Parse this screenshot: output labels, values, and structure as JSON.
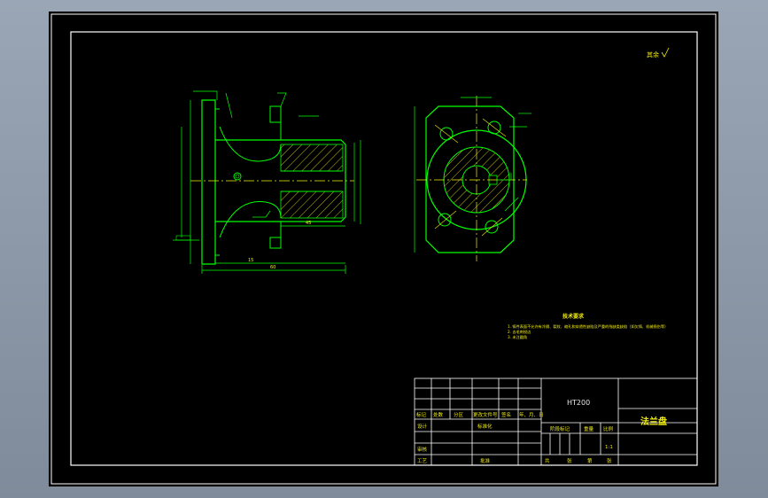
{
  "colors": {
    "background": "#000000",
    "frame": "#ffffff",
    "outline": "#00ff00",
    "text": "#f2ee10",
    "hatch": "#f2ee10",
    "centerline": "#f2ee10",
    "dimension": "#00ff00"
  },
  "drawing": {
    "roughness_note": "其余",
    "technical_requirements_title": "技术要求",
    "technical_requirements_line1": "1. 铸件表面不允许有冷隔、裂纹、缩孔和穿透性缺陷及严重的残缺类缺陷（如欠铸、机械损伤等）",
    "technical_requirements_line2": "2. 去毛刺锐边",
    "technical_requirements_line3": "3. 未注圆角",
    "dim_total_length": "60",
    "dim_flange": "15",
    "dim_shaft": "45"
  },
  "title_block": {
    "material": "HT200",
    "part_name": "法兰盘",
    "col_mark": "标记",
    "col_count": "处数",
    "col_zone": "分区",
    "col_change_doc": "更改文件号",
    "col_sign": "签名",
    "col_date": "年、月、日",
    "design": "设计",
    "standardize": "标准化",
    "stage_mark": "阶段标记",
    "weight": "重量",
    "scale": "比例",
    "scale_value": "1:1",
    "review": "审核",
    "process": "工艺",
    "approve": "批准",
    "sheet_total": "共",
    "sheet_unit": "张",
    "sheet_index": "第",
    "sheet_unit2": "张"
  }
}
